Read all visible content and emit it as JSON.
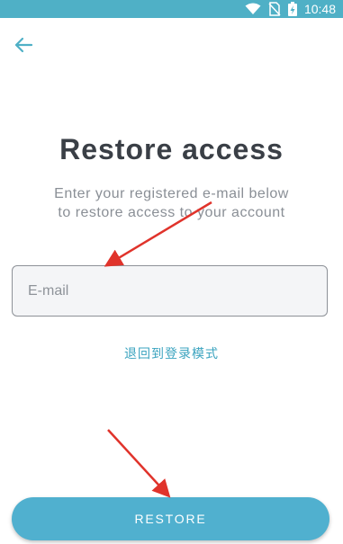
{
  "status_bar": {
    "time": "10:48",
    "icons": [
      "wifi-icon",
      "no-sim-icon",
      "battery-charging-icon"
    ]
  },
  "header": {
    "back_icon": "arrow-left-icon"
  },
  "main": {
    "title": "Restore access",
    "subtitle_line1": "Enter your registered e-mail below",
    "subtitle_line2": "to restore access to your account",
    "email_placeholder": "E-mail",
    "email_value": "",
    "login_link": "退回到登录模式",
    "restore_button": "RESTORE"
  },
  "colors": {
    "accent": "#4fb0c6",
    "button": "#50b0cf",
    "link": "#3aa3bf",
    "annotation_arrow": "#e0332b"
  },
  "annotations": [
    "red-arrow-icon",
    "red-arrow-icon"
  ]
}
